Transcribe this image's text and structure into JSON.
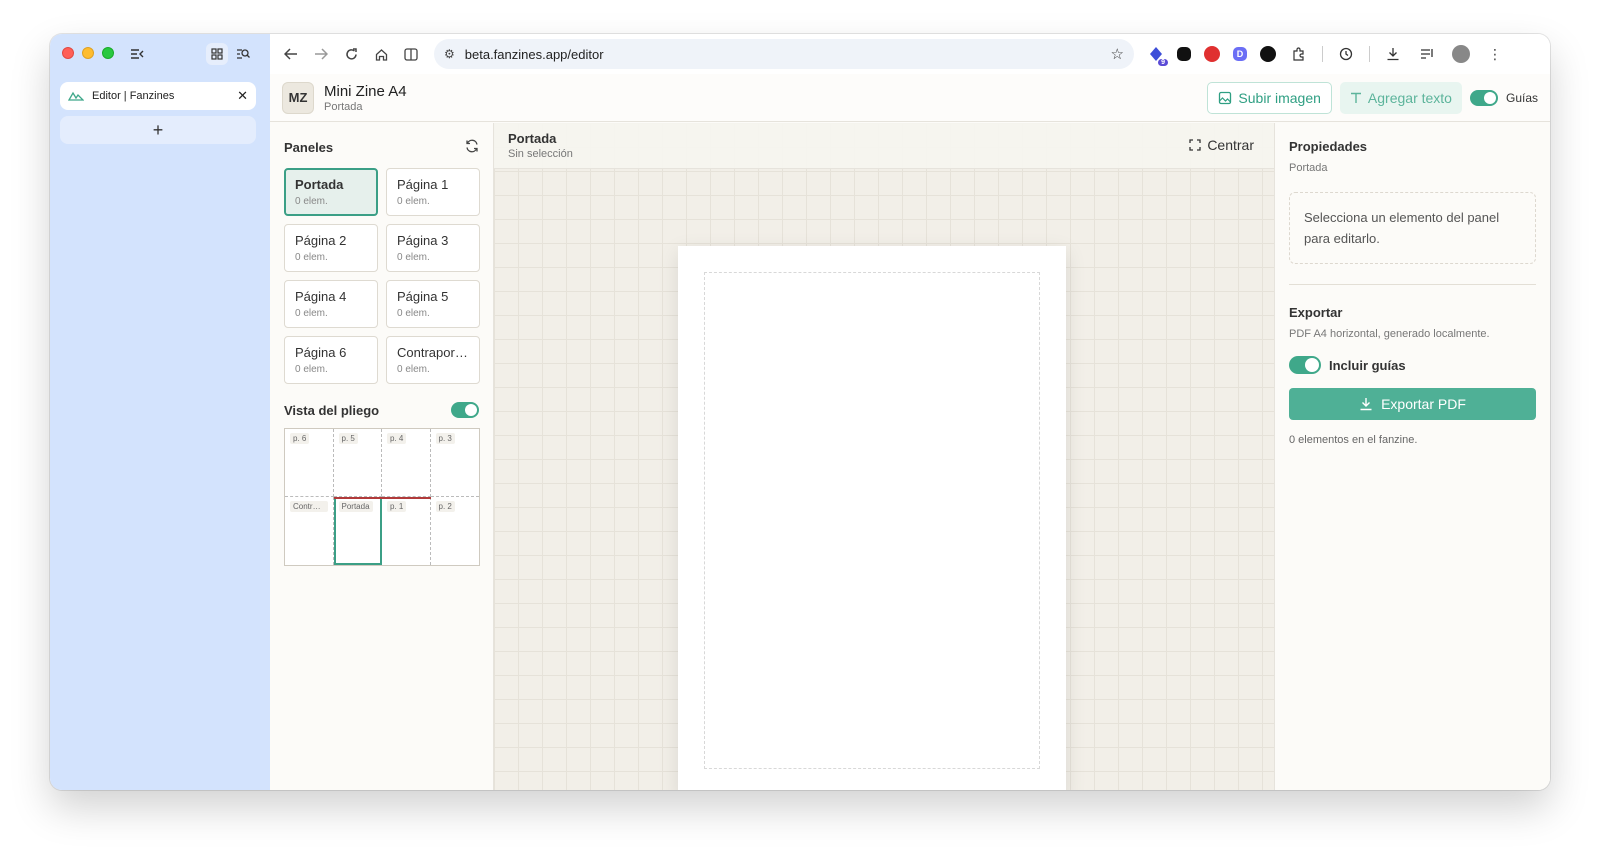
{
  "browser": {
    "tab_title": "Editor | Fanzines",
    "url": "beta.fanzines.app/editor",
    "new_tab_symbol": "+",
    "extension_badge": "9"
  },
  "header": {
    "logo": "MZ",
    "title": "Mini Zine A4",
    "subtitle": "Portada",
    "upload_label": "Subir imagen",
    "add_text_label": "Agregar texto",
    "guides_label": "Guías"
  },
  "panels": {
    "title": "Paneles",
    "items": [
      {
        "name": "Portada",
        "count": "0 elem."
      },
      {
        "name": "Página 1",
        "count": "0 elem."
      },
      {
        "name": "Página 2",
        "count": "0 elem."
      },
      {
        "name": "Página 3",
        "count": "0 elem."
      },
      {
        "name": "Página 4",
        "count": "0 elem."
      },
      {
        "name": "Página 5",
        "count": "0 elem."
      },
      {
        "name": "Página 6",
        "count": "0 elem."
      },
      {
        "name": "Contraportada",
        "count": "0 elem."
      }
    ],
    "spread_title": "Vista del pliego",
    "spread_cells": [
      "p. 6",
      "p. 5",
      "p. 4",
      "p. 3",
      "Contraportada",
      "Portada",
      "p. 1",
      "p. 2"
    ]
  },
  "canvas": {
    "title": "Portada",
    "subtitle": "Sin selección",
    "center_label": "Centrar"
  },
  "properties": {
    "title": "Propiedades",
    "subtitle": "Portada",
    "empty_message": "Selecciona un elemento del panel para editarlo.",
    "export_title": "Exportar",
    "export_sub": "PDF A4 horizontal, generado localmente.",
    "include_guides_label": "Incluir guías",
    "export_button_label": "Exportar PDF",
    "count_note": "0 elementos en el fanzine."
  },
  "colors": {
    "accent": "#4fb096",
    "sidebar_bg": "#d3e3fd"
  }
}
